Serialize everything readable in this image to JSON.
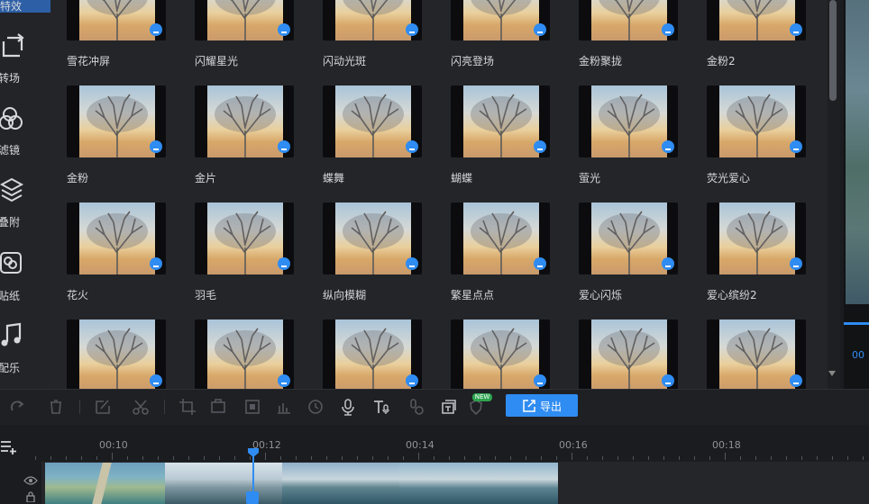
{
  "sidebar": {
    "items": [
      {
        "label": "特效",
        "icon": "effects-icon"
      },
      {
        "label": "转场",
        "icon": "transition-icon"
      },
      {
        "label": "滤镜",
        "icon": "filter-icon"
      },
      {
        "label": "叠附",
        "icon": "overlay-icon"
      },
      {
        "label": "贴纸",
        "icon": "sticker-icon"
      },
      {
        "label": "配乐",
        "icon": "music-note-icon"
      }
    ]
  },
  "effects": [
    {
      "label": "雪花冲屏"
    },
    {
      "label": "闪耀星光"
    },
    {
      "label": "闪动光斑"
    },
    {
      "label": "闪亮登场"
    },
    {
      "label": "金粉聚拢"
    },
    {
      "label": "金粉2"
    },
    {
      "label": "金粉"
    },
    {
      "label": "金片"
    },
    {
      "label": "蝶舞"
    },
    {
      "label": "蝴蝶"
    },
    {
      "label": "萤光"
    },
    {
      "label": "荧光爱心"
    },
    {
      "label": "花火"
    },
    {
      "label": "羽毛"
    },
    {
      "label": "纵向模糊"
    },
    {
      "label": "繁星点点"
    },
    {
      "label": "爱心闪烁"
    },
    {
      "label": "爱心缤纷2"
    },
    {
      "label": ""
    },
    {
      "label": ""
    },
    {
      "label": ""
    },
    {
      "label": ""
    },
    {
      "label": ""
    },
    {
      "label": ""
    }
  ],
  "toolbar": {
    "export_label": "导出",
    "new_badge": "NEW"
  },
  "preview": {
    "time": "00"
  },
  "timeline": {
    "ticks": [
      "00:10",
      "00:12",
      "00:14",
      "00:16",
      "00:18"
    ]
  },
  "colors": {
    "accent": "#2f8cf2",
    "background": "#1b1c1f",
    "new_badge": "#2ea44f"
  }
}
